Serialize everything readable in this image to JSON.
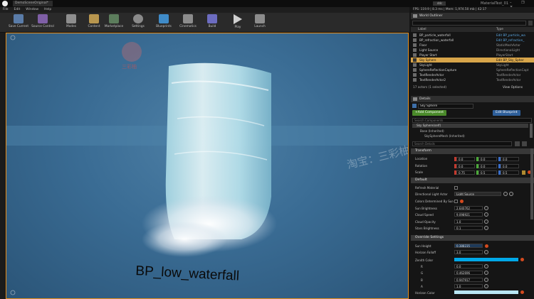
{
  "window": {
    "tab": "DemoSceneOriginal*",
    "app_title": "MaterialTest_01",
    "controls": "– ❐ ✕"
  },
  "menu": [
    "File",
    "Edit",
    "Window",
    "Help"
  ],
  "toolbar": [
    {
      "label": "Save Current",
      "color": "#6a8ab8"
    },
    {
      "label": "Source Control",
      "color": "#8a6ab0"
    },
    {
      "label": "Modes",
      "color": "#a0a0a0"
    },
    {
      "label": "Content",
      "color": "#c8a860"
    },
    {
      "label": "Marketplace",
      "color": "#6a8a6a"
    },
    {
      "label": "Settings",
      "color": "#9a9a9a"
    },
    {
      "label": "Blueprints",
      "color": "#4e9ad8"
    },
    {
      "label": "Cinematics",
      "color": "#9a9a9a"
    },
    {
      "label": "Build",
      "color": "#7a7ad0"
    },
    {
      "label": "Play",
      "color": "#cfcfcf"
    },
    {
      "label": "Launch",
      "color": "#9a9a9a"
    }
  ],
  "viewport": {
    "object_label": "BP_low_waterfall",
    "watermark_logo": "三彩柚",
    "watermark_text": "淘宝：三彩柚素材"
  },
  "stats": "FPS: 119.9 | 8.3 ms | Mem: 1,974.50 mb | 42:17",
  "outliner": {
    "title": "World Outliner",
    "columns": [
      "Label",
      "Type"
    ],
    "rows": [
      {
        "label": "BP_particle_waterfall",
        "type": "Edit BP_particle_wa"
      },
      {
        "label": "BP_refraction_waterfall",
        "type": "Edit BP_refraction_"
      },
      {
        "label": "Floor",
        "type": "StaticMeshActor"
      },
      {
        "label": "Light Source",
        "type": "DirectionalLight"
      },
      {
        "label": "Player Start",
        "type": "PlayerStart"
      },
      {
        "label": "Sky Sphere",
        "type": "Edit BP_Sky_Spher",
        "selected": true
      },
      {
        "label": "SkyLight",
        "type": "SkyLight"
      },
      {
        "label": "SphereReflectionCapture",
        "type": "SphereReflectionCapt"
      },
      {
        "label": "TextRenderActor",
        "type": "TextRenderActor"
      },
      {
        "label": "TextRenderActor2",
        "type": "TextRenderActor"
      }
    ],
    "footer": "17 actors (1 selected)",
    "view_options": "View Options"
  },
  "details": {
    "title": "Details",
    "name": "Sky Sphere",
    "add_component": "+Add Component",
    "edit_blueprint": "Edit Blueprint",
    "search_components": "Search Components",
    "tree": [
      "Sky Sphere(self)",
      "Base (Inherited)",
      "SkySphereMesh (Inherited)"
    ],
    "search_details": "Search Details",
    "transform": {
      "title": "Transform",
      "location": "Location",
      "rotation": "Rotation",
      "scale": "Scale",
      "loc": [
        "0.0",
        "0.0",
        "0.0"
      ],
      "rot": [
        "0.0",
        "0.0",
        "0.0"
      ],
      "scl": [
        "0.75",
        "0.5",
        "0.5"
      ]
    },
    "default": {
      "title": "Default",
      "props": [
        {
          "name": "Refresh Material",
          "value": ""
        },
        {
          "name": "Directional Light Actor",
          "value": "Light Source"
        },
        {
          "name": "Colors Determined By Sun",
          "value": ""
        },
        {
          "name": "Sun Brightness",
          "value": "2.640762"
        },
        {
          "name": "Cloud Speed",
          "value": "9.098921"
        },
        {
          "name": "Cloud Opacity",
          "value": "1.0"
        },
        {
          "name": "Stars Brightness",
          "value": "0.1"
        }
      ]
    },
    "override": {
      "title": "Override Settings",
      "props": [
        {
          "name": "Sun Height",
          "value": "0.388235"
        },
        {
          "name": "Horizon Falloff",
          "value": "3.0"
        },
        {
          "name": "Zenith Color",
          "value": ""
        },
        {
          "name": "R",
          "value": "0.0"
        },
        {
          "name": "G",
          "value": "0.462696"
        },
        {
          "name": "B",
          "value": "0.947917"
        },
        {
          "name": "A",
          "value": "1.0"
        },
        {
          "name": "Horizon Color",
          "value": ""
        }
      ]
    }
  }
}
